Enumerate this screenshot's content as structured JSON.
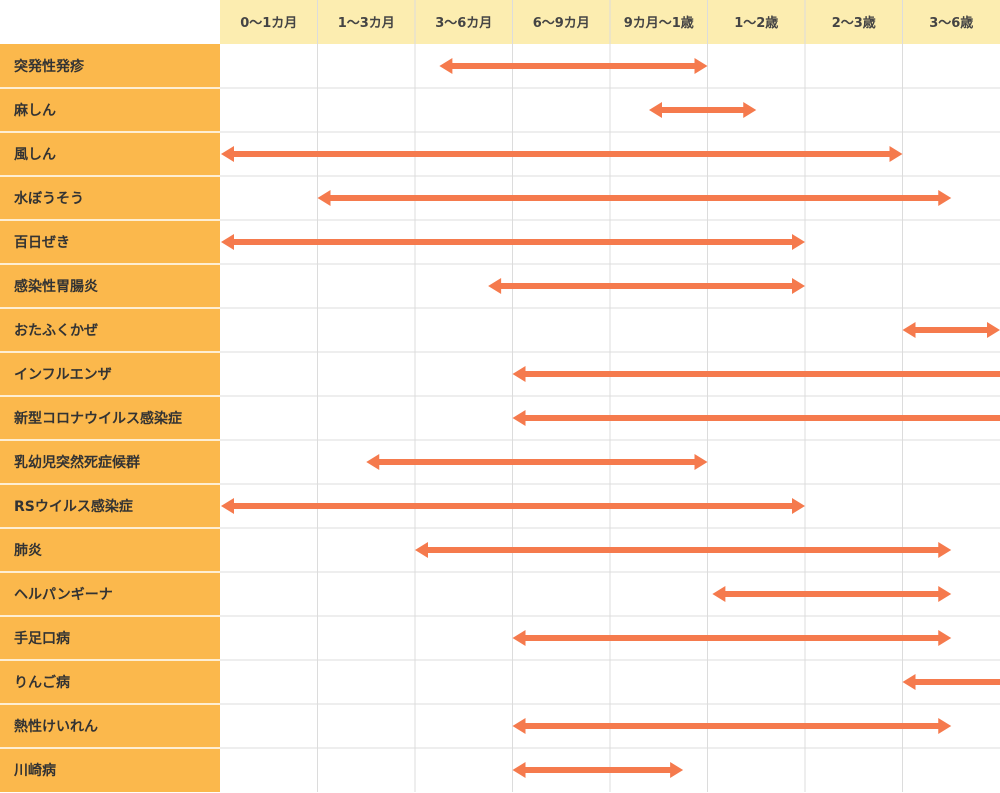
{
  "chart_data": {
    "type": "gantt",
    "columns": [
      "0〜1カ月",
      "1〜3カ月",
      "3〜6カ月",
      "6〜9カ月",
      "9カ月〜1歳",
      "1〜2歳",
      "2〜3歳",
      "3〜6歳"
    ],
    "rows": [
      {
        "label": "突発性発疹",
        "start": 2.25,
        "end": 5.0,
        "start_arrow": true,
        "end_arrow": true
      },
      {
        "label": "麻しん",
        "start": 4.4,
        "end": 5.5,
        "start_arrow": true,
        "end_arrow": true
      },
      {
        "label": "風しん",
        "start": 0.0,
        "end": 7.0,
        "start_arrow": true,
        "end_arrow": true
      },
      {
        "label": "水ぼうそう",
        "start": 1.0,
        "end": 7.5,
        "start_arrow": true,
        "end_arrow": true
      },
      {
        "label": "百日ぜき",
        "start": 0.0,
        "end": 6.0,
        "start_arrow": true,
        "end_arrow": true
      },
      {
        "label": "感染性胃腸炎",
        "start": 2.75,
        "end": 6.0,
        "start_arrow": true,
        "end_arrow": true
      },
      {
        "label": "おたふくかぜ",
        "start": 7.0,
        "end": 8.0,
        "start_arrow": true,
        "end_arrow": true
      },
      {
        "label": "インフルエンザ",
        "start": 3.0,
        "end": 8.0,
        "start_arrow": true,
        "end_arrow": false
      },
      {
        "label": "新型コロナウイルス感染症",
        "start": 3.0,
        "end": 8.0,
        "start_arrow": true,
        "end_arrow": false
      },
      {
        "label": "乳幼児突然死症候群",
        "start": 1.5,
        "end": 5.0,
        "start_arrow": true,
        "end_arrow": true
      },
      {
        "label": "RSウイルス感染症",
        "start": 0.0,
        "end": 6.0,
        "start_arrow": true,
        "end_arrow": true
      },
      {
        "label": "肺炎",
        "start": 2.0,
        "end": 7.5,
        "start_arrow": true,
        "end_arrow": true
      },
      {
        "label": "ヘルパンギーナ",
        "start": 5.05,
        "end": 7.5,
        "start_arrow": true,
        "end_arrow": true
      },
      {
        "label": "手足口病",
        "start": 3.0,
        "end": 7.5,
        "start_arrow": true,
        "end_arrow": true
      },
      {
        "label": "りんご病",
        "start": 7.0,
        "end": 8.0,
        "start_arrow": true,
        "end_arrow": false
      },
      {
        "label": "熱性けいれん",
        "start": 3.0,
        "end": 7.5,
        "start_arrow": true,
        "end_arrow": true
      },
      {
        "label": "川崎病",
        "start": 3.0,
        "end": 4.75,
        "start_arrow": true,
        "end_arrow": true
      }
    ]
  },
  "colors": {
    "header_bg": "#fcedb0",
    "label_bg": "#fbb84c",
    "arrow": "#f57a4d",
    "grid": "#dcdcdc",
    "row_divider": "#ffffff"
  }
}
